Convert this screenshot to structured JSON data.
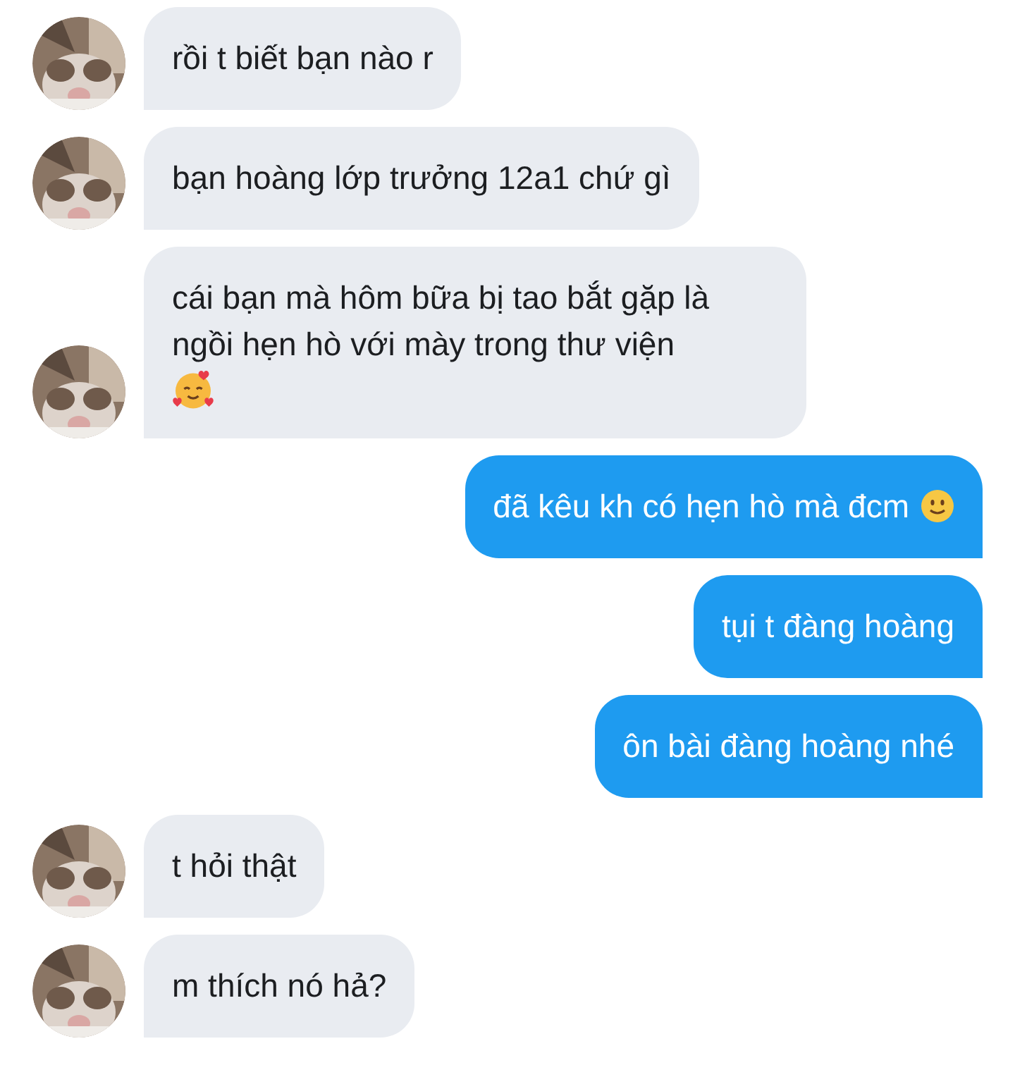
{
  "messages": [
    {
      "kind": "incoming",
      "text": "rồi t biết bạn nào r"
    },
    {
      "kind": "incoming",
      "text": "bạn hoàng lớp trưởng 12a1 chứ gì"
    },
    {
      "kind": "incoming",
      "text": "cái bạn mà hôm bữa bị tao bắt gặp là ngồi hẹn hò với mày trong thư viện",
      "emoji": true
    },
    {
      "kind": "outgoing",
      "text": "đã kêu kh có hẹn hò mà đcm",
      "emoji": true
    },
    {
      "kind": "outgoing",
      "text": "tụi t đàng hoàng"
    },
    {
      "kind": "outgoing",
      "text": "ôn bài đàng hoàng nhé"
    },
    {
      "kind": "incoming",
      "text": "t hỏi thật"
    },
    {
      "kind": "incoming",
      "text": "m thích nó hả?"
    }
  ]
}
